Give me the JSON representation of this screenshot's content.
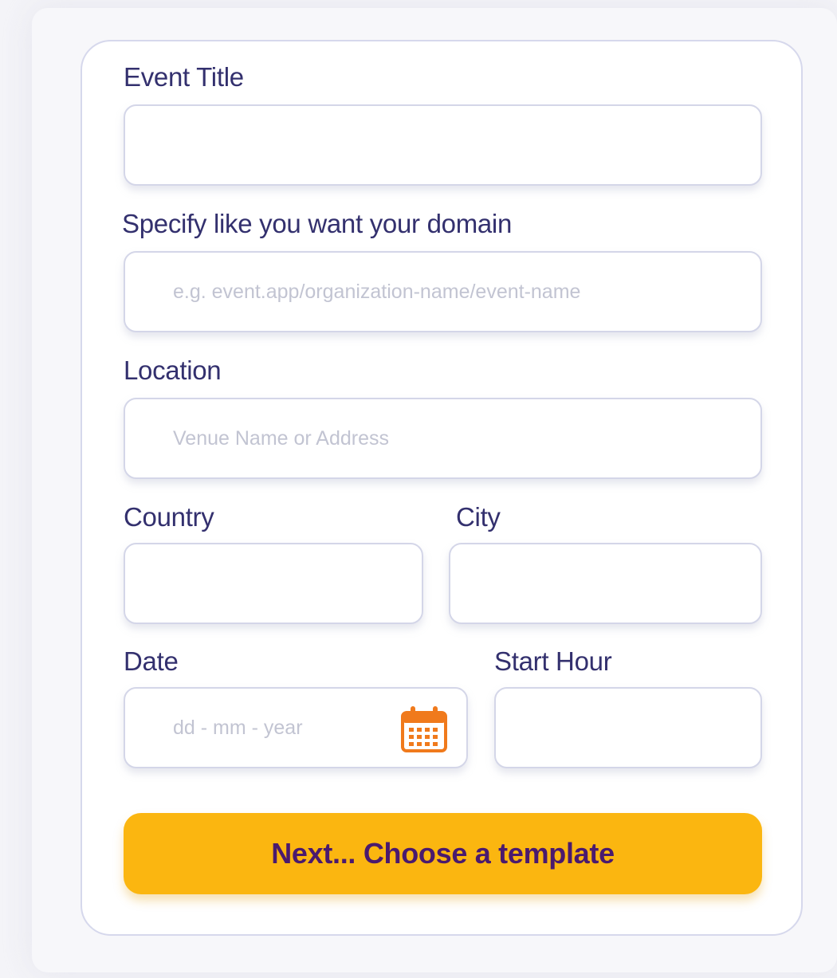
{
  "form": {
    "event_title": {
      "label": "Event Title",
      "value": "",
      "placeholder": ""
    },
    "domain": {
      "label": "Specify like you want your domain",
      "value": "",
      "placeholder": "e.g. event.app/organization-name/event-name"
    },
    "location": {
      "label": "Location",
      "value": "",
      "placeholder": "Venue Name or Address"
    },
    "country": {
      "label": "Country",
      "value": "",
      "placeholder": ""
    },
    "city": {
      "label": "City",
      "value": "",
      "placeholder": ""
    },
    "date": {
      "label": "Date",
      "value": "",
      "placeholder": "dd - mm - year",
      "icon": "calendar-icon"
    },
    "start_hour": {
      "label": "Start Hour",
      "value": "",
      "placeholder": ""
    },
    "next_button_label": "Next... Choose a template"
  },
  "colors": {
    "label": "#33306e",
    "button_bg": "#fbb610",
    "button_text": "#4a1a6e",
    "calendar_icon": "#f07a1c"
  }
}
